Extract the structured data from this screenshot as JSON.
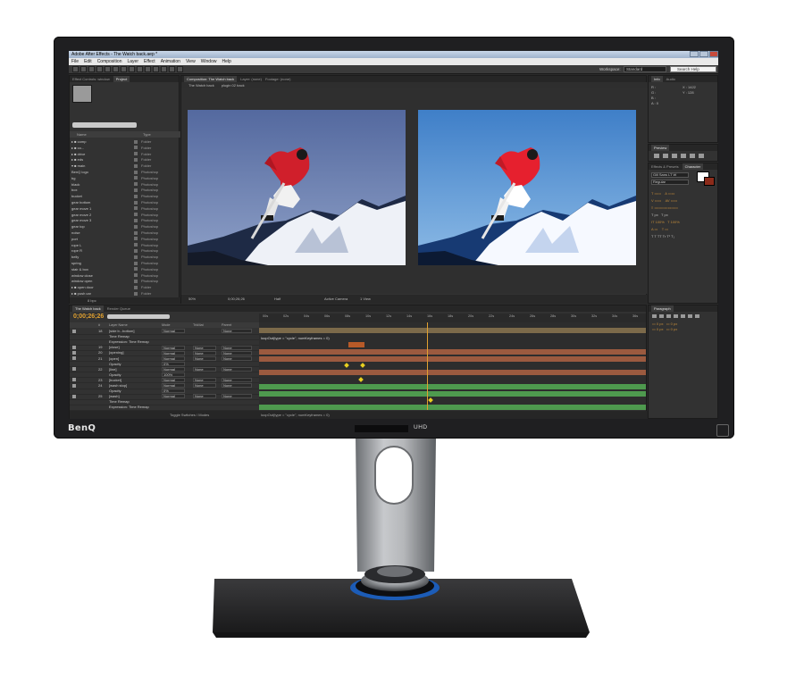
{
  "app": {
    "title": "Adobe After Effects - The Watch back.aep *",
    "menu": [
      "File",
      "Edit",
      "Composition",
      "Layer",
      "Effect",
      "Animation",
      "View",
      "Window",
      "Help"
    ],
    "workspace_label": "Workspace:",
    "workspace_value": "Standard",
    "search_placeholder": "Search Help"
  },
  "project_panel": {
    "tabs": [
      "Effect Controls: window",
      "Project"
    ],
    "col_name": "Name",
    "col_type": "Type",
    "items": [
      {
        "name": "▸ ■ comp",
        "type": "Folder"
      },
      {
        "name": "▸ ■ co...",
        "type": "Folder"
      },
      {
        "name": "  ▸ ■ drive",
        "type": "Folder"
      },
      {
        "name": "  ▸ ■ eds",
        "type": "Folder"
      },
      {
        "name": "  ▾ ■ main",
        "type": "Folder"
      },
      {
        "name": "     BenQ logo",
        "type": "Photoshop"
      },
      {
        "name": "     bg",
        "type": "Photoshop"
      },
      {
        "name": "     black",
        "type": "Photoshop"
      },
      {
        "name": "     box",
        "type": "Photoshop"
      },
      {
        "name": "     bucket",
        "type": "Photoshop"
      },
      {
        "name": "     gear bottom",
        "type": "Photoshop"
      },
      {
        "name": "     gear move 1",
        "type": "Photoshop"
      },
      {
        "name": "     gear move 2",
        "type": "Photoshop"
      },
      {
        "name": "     gear move 3",
        "type": "Photoshop"
      },
      {
        "name": "     gear top",
        "type": "Photoshop"
      },
      {
        "name": "     noise",
        "type": "Photoshop"
      },
      {
        "name": "     port",
        "type": "Photoshop"
      },
      {
        "name": "     rope L",
        "type": "Photoshop"
      },
      {
        "name": "     rope R",
        "type": "Photoshop"
      },
      {
        "name": "     belly",
        "type": "Photoshop"
      },
      {
        "name": "     spring",
        "type": "Photoshop"
      },
      {
        "name": "     stair & box",
        "type": "Photoshop"
      },
      {
        "name": "     window close",
        "type": "Photoshop"
      },
      {
        "name": "     window open",
        "type": "Photoshop"
      },
      {
        "name": "  ▸ ■ open door",
        "type": "Folder"
      },
      {
        "name": "  ▸ ■ push car",
        "type": "Folder"
      }
    ],
    "footer": "8 bpc"
  },
  "composition": {
    "tabs": [
      "Composition: The Watch back",
      "Layer: (none)",
      "Footage: (none)"
    ],
    "subtabs": [
      "The Watch back",
      "plugin 02 back"
    ],
    "zoom": "50%",
    "timecode": "0;00;26;26",
    "resolution": "Half",
    "camera": "Active Camera",
    "views": "1 View"
  },
  "right_panel": {
    "info_tabs": [
      "Info",
      "Audio"
    ],
    "info_lines": [
      "R :",
      "G :",
      "B :",
      "A : 0"
    ],
    "info_xy": [
      "X : 1422",
      "Y : 128"
    ],
    "preview_tab": "Preview",
    "effects_tab": "Effects & Presets",
    "char_tab": "Character",
    "paragraph_tab": "Paragraph",
    "font_name": "Gill Sans LT W",
    "font_style": "Regular",
    "px_values": [
      "px",
      "px"
    ]
  },
  "timeline": {
    "tabs": [
      "The Watch back",
      "Render Queue"
    ],
    "timecode": "0;00;26;26",
    "ruler": [
      "00s",
      "02s",
      "04s",
      "06s",
      "08s",
      "10s",
      "12s",
      "14s",
      "16s",
      "18s",
      "20s",
      "22s",
      "24s",
      "26s",
      "28s",
      "30s",
      "32s",
      "34s",
      "36s"
    ],
    "col_headers": [
      "#",
      "Layer Name",
      "Mode",
      "TrkMat",
      "Parent"
    ],
    "rows": [
      {
        "num": "18",
        "name": "[side b...bottom]",
        "mode": "Normal",
        "trk": "",
        "par": "None"
      },
      {
        "num": "",
        "name": "Time Remap",
        "mode": "",
        "trk": "",
        "par": ""
      },
      {
        "num": "",
        "name": "Expression: Time Remap",
        "mode": "",
        "trk": "",
        "par": ""
      },
      {
        "num": "19",
        "name": "[close]",
        "mode": "Normal",
        "trk": "None",
        "par": "None"
      },
      {
        "num": "20",
        "name": "[opening]",
        "mode": "Normal",
        "trk": "None",
        "par": "None"
      },
      {
        "num": "21",
        "name": "[open]",
        "mode": "Normal",
        "trk": "None",
        "par": "None"
      },
      {
        "num": "",
        "name": "Opacity",
        "mode": "0%",
        "trk": "",
        "par": ""
      },
      {
        "num": "22",
        "name": "[line]",
        "mode": "Normal",
        "trk": "None",
        "par": "None"
      },
      {
        "num": "",
        "name": "Opacity",
        "mode": "100%",
        "trk": "",
        "par": ""
      },
      {
        "num": "23",
        "name": "[bucket]",
        "mode": "Normal",
        "trk": "None",
        "par": "None"
      },
      {
        "num": "24",
        "name": "[wash stop]",
        "mode": "Normal",
        "trk": "None",
        "par": "None"
      },
      {
        "num": "",
        "name": "Opacity",
        "mode": "0%",
        "trk": "",
        "par": ""
      },
      {
        "num": "25",
        "name": "[wash]",
        "mode": "Normal",
        "trk": "None",
        "par": "None"
      },
      {
        "num": "",
        "name": "Time Remap",
        "mode": "",
        "trk": "",
        "par": ""
      },
      {
        "num": "",
        "name": "Expression: Time Remap",
        "mode": "",
        "trk": "",
        "par": ""
      }
    ],
    "expressions": [
      "loopOut(type = \"cycle\", numKeyframes = 0)",
      "loopOut(type = \"cycle\", numKeyframes = 0)"
    ],
    "footer": "Toggle Switches / Modes"
  },
  "monitor": {
    "brand": "BenQ",
    "badge": "UHD"
  }
}
